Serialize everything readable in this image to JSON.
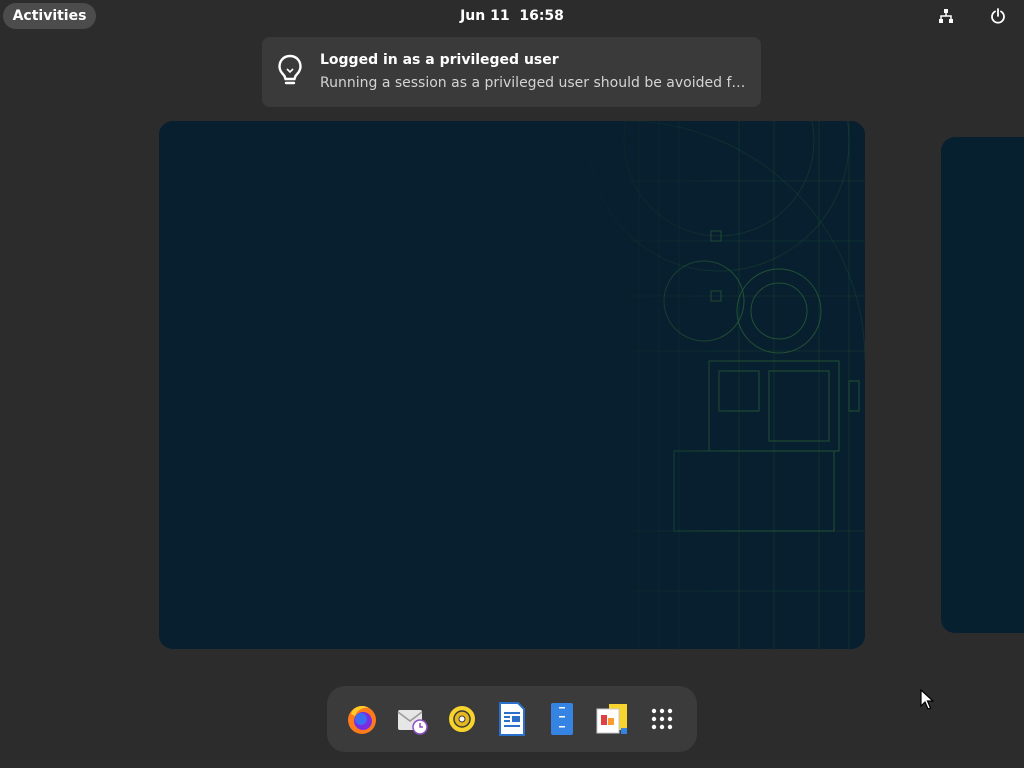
{
  "topbar": {
    "activities_label": "Activities",
    "clock": "Jun 11  16:58",
    "tray": [
      "network-icon",
      "power-icon"
    ]
  },
  "notification": {
    "icon": "lightbulb-icon",
    "title": "Logged in as a privileged user",
    "body": "Running a session as a privileged user should be avoided for sec…"
  },
  "workspaces": {
    "count_visible": 2,
    "background_color": "#071f2e",
    "accent_color": "#3b7a3a"
  },
  "dash": {
    "items": [
      {
        "name": "firefox-icon"
      },
      {
        "name": "evolution-mail-icon"
      },
      {
        "name": "rhythmbox-icon"
      },
      {
        "name": "libreoffice-writer-icon"
      },
      {
        "name": "text-editor-icon"
      },
      {
        "name": "libreoffice-impress-icon"
      },
      {
        "name": "show-apps-icon"
      }
    ]
  }
}
